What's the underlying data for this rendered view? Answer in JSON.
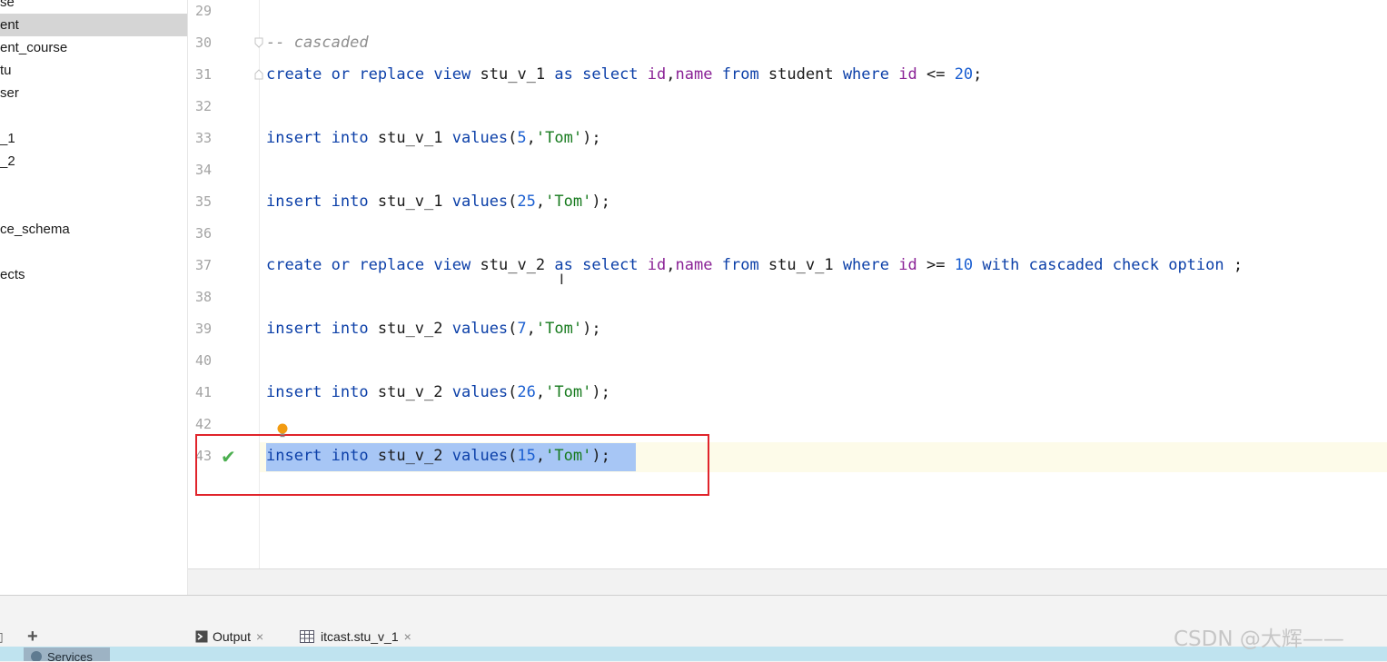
{
  "tree": {
    "items": [
      {
        "label": "se"
      },
      {
        "label": "ent",
        "selected": true
      },
      {
        "label": "ent_course"
      },
      {
        "label": "tu"
      },
      {
        "label": "ser"
      },
      {
        "label": ""
      },
      {
        "label": "_1"
      },
      {
        "label": "_2"
      },
      {
        "label": ""
      },
      {
        "label": ""
      },
      {
        "label": "ce_schema"
      },
      {
        "label": ""
      },
      {
        "label": "ects"
      }
    ]
  },
  "editor": {
    "line_numbers": [
      "29",
      "30",
      "31",
      "32",
      "33",
      "34",
      "35",
      "36",
      "37",
      "38",
      "39",
      "40",
      "41",
      "42",
      "43"
    ],
    "lines": [
      [],
      [
        {
          "t": "-- cascaded",
          "c": "cmt"
        }
      ],
      [
        {
          "t": "create",
          "c": "kw"
        },
        {
          "t": " "
        },
        {
          "t": "or",
          "c": "kw"
        },
        {
          "t": " "
        },
        {
          "t": "replace",
          "c": "kw"
        },
        {
          "t": " "
        },
        {
          "t": "view",
          "c": "kw"
        },
        {
          "t": " stu_v_1 "
        },
        {
          "t": "as",
          "c": "kw"
        },
        {
          "t": " "
        },
        {
          "t": "select",
          "c": "kw"
        },
        {
          "t": " "
        },
        {
          "t": "id",
          "c": "fld"
        },
        {
          "t": ","
        },
        {
          "t": "name",
          "c": "fld"
        },
        {
          "t": " "
        },
        {
          "t": "from",
          "c": "kw"
        },
        {
          "t": " student "
        },
        {
          "t": "where",
          "c": "kw"
        },
        {
          "t": " "
        },
        {
          "t": "id",
          "c": "fld"
        },
        {
          "t": " <= "
        },
        {
          "t": "20",
          "c": "num"
        },
        {
          "t": ";"
        }
      ],
      [],
      [
        {
          "t": "insert",
          "c": "kw"
        },
        {
          "t": " "
        },
        {
          "t": "into",
          "c": "kw"
        },
        {
          "t": " stu_v_1 "
        },
        {
          "t": "values",
          "c": "kw"
        },
        {
          "t": "("
        },
        {
          "t": "5",
          "c": "num"
        },
        {
          "t": ","
        },
        {
          "t": "'Tom'",
          "c": "str"
        },
        {
          "t": ");"
        }
      ],
      [],
      [
        {
          "t": "insert",
          "c": "kw"
        },
        {
          "t": " "
        },
        {
          "t": "into",
          "c": "kw"
        },
        {
          "t": " stu_v_1 "
        },
        {
          "t": "values",
          "c": "kw"
        },
        {
          "t": "("
        },
        {
          "t": "25",
          "c": "num"
        },
        {
          "t": ","
        },
        {
          "t": "'Tom'",
          "c": "str"
        },
        {
          "t": ");"
        }
      ],
      [],
      [
        {
          "t": "create",
          "c": "kw"
        },
        {
          "t": " "
        },
        {
          "t": "or",
          "c": "kw"
        },
        {
          "t": " "
        },
        {
          "t": "replace",
          "c": "kw"
        },
        {
          "t": " "
        },
        {
          "t": "view",
          "c": "kw"
        },
        {
          "t": " stu_v_2 "
        },
        {
          "t": "as",
          "c": "kw"
        },
        {
          "t": " "
        },
        {
          "t": "select",
          "c": "kw"
        },
        {
          "t": " "
        },
        {
          "t": "id",
          "c": "fld"
        },
        {
          "t": ","
        },
        {
          "t": "name",
          "c": "fld"
        },
        {
          "t": " "
        },
        {
          "t": "from",
          "c": "kw"
        },
        {
          "t": " stu_v_1 "
        },
        {
          "t": "where",
          "c": "kw"
        },
        {
          "t": " "
        },
        {
          "t": "id",
          "c": "fld"
        },
        {
          "t": " >= "
        },
        {
          "t": "10",
          "c": "num"
        },
        {
          "t": " "
        },
        {
          "t": "with",
          "c": "kw"
        },
        {
          "t": " "
        },
        {
          "t": "cascaded",
          "c": "kw"
        },
        {
          "t": " "
        },
        {
          "t": "check",
          "c": "kw"
        },
        {
          "t": " "
        },
        {
          "t": "option",
          "c": "kw"
        },
        {
          "t": " ;"
        }
      ],
      [],
      [
        {
          "t": "insert",
          "c": "kw"
        },
        {
          "t": " "
        },
        {
          "t": "into",
          "c": "kw"
        },
        {
          "t": " stu_v_2 "
        },
        {
          "t": "values",
          "c": "kw"
        },
        {
          "t": "("
        },
        {
          "t": "7",
          "c": "num"
        },
        {
          "t": ","
        },
        {
          "t": "'Tom'",
          "c": "str"
        },
        {
          "t": ");"
        }
      ],
      [],
      [
        {
          "t": "insert",
          "c": "kw"
        },
        {
          "t": " "
        },
        {
          "t": "into",
          "c": "kw"
        },
        {
          "t": " stu_v_2 "
        },
        {
          "t": "values",
          "c": "kw"
        },
        {
          "t": "("
        },
        {
          "t": "26",
          "c": "num"
        },
        {
          "t": ","
        },
        {
          "t": "'Tom'",
          "c": "str"
        },
        {
          "t": ");"
        }
      ],
      [],
      [
        {
          "t": "insert",
          "c": "kw"
        },
        {
          "t": " "
        },
        {
          "t": "into",
          "c": "kw"
        },
        {
          "t": " stu_v_2 "
        },
        {
          "t": "values",
          "c": "kw"
        },
        {
          "t": "("
        },
        {
          "t": "15",
          "c": "num"
        },
        {
          "t": ","
        },
        {
          "t": "'Tom'",
          "c": "str"
        },
        {
          "t": ");"
        }
      ]
    ],
    "current_line": "43",
    "status_icon": "check-icon",
    "colors": {
      "keyword": "#0b3fa8",
      "field": "#8a2296",
      "number": "#1b5fd1",
      "string": "#167a1d",
      "comment": "#8f8f8f",
      "selection": "#a7c6f5",
      "highlight_box": "#e0242b"
    }
  },
  "bottom": {
    "add_label": "+",
    "tabs": [
      {
        "label": "Output",
        "icon": "console-icon"
      },
      {
        "label": "itcast.stu_v_1",
        "icon": "table-icon"
      }
    ],
    "services_label": "Services",
    "watermark": "CSDN @大辉——"
  }
}
